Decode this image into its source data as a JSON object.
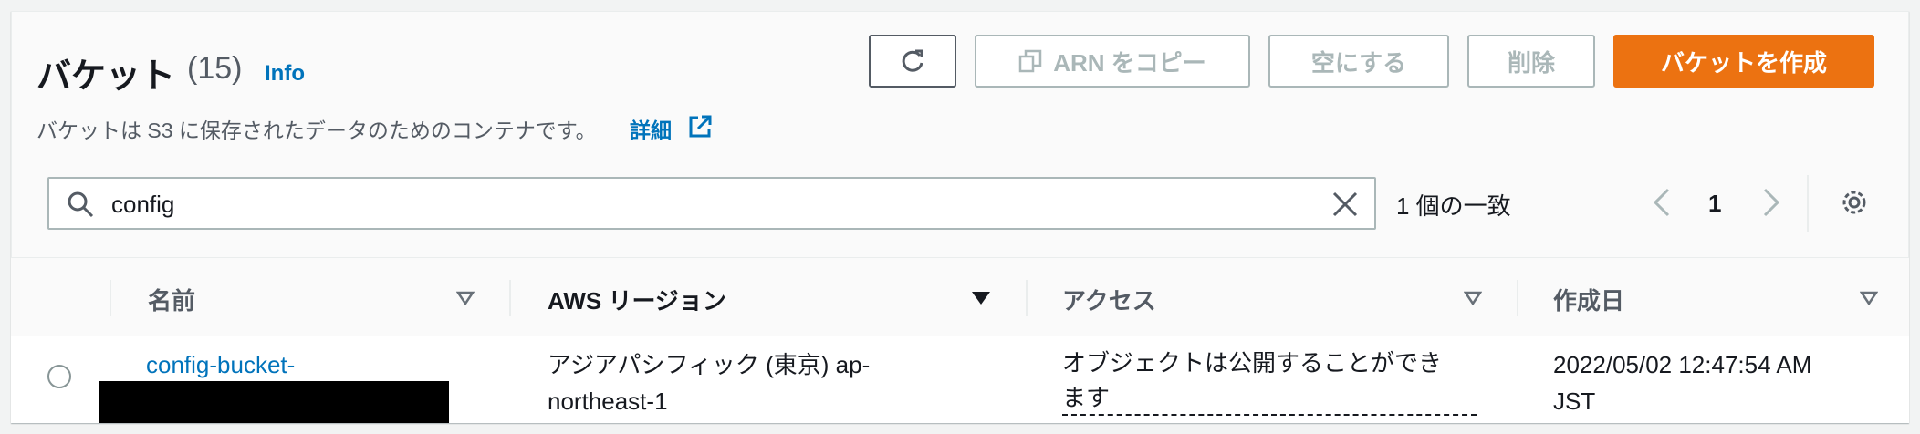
{
  "header": {
    "title": "バケット",
    "count": "(15)",
    "info_label": "Info",
    "description": "バケットは S3 に保存されたデータのためのコンテナです。",
    "details_link": "詳細"
  },
  "actions": {
    "refresh_icon": "refresh-icon",
    "copy_arn_label": "ARN をコピー",
    "empty_label": "空にする",
    "delete_label": "削除",
    "create_label": "バケットを作成"
  },
  "search": {
    "value": "config",
    "match_text": "1 個の一致"
  },
  "pagination": {
    "current_page": "1"
  },
  "table": {
    "columns": [
      "名前",
      "AWS リージョン",
      "アクセス",
      "作成日"
    ],
    "rows": [
      {
        "name": "config-bucket-",
        "region_line1": "アジアパシフィック (東京) ap-",
        "region_line2": "northeast-1",
        "access_line1": "オブジェクトは公開することができ",
        "access_line2": "ます",
        "created_line1": "2022/05/02 12:47:54 AM",
        "created_line2": "JST"
      }
    ]
  },
  "colors": {
    "primary": "#ec7211",
    "link": "#0073bb",
    "disabled": "#aab7b8"
  }
}
